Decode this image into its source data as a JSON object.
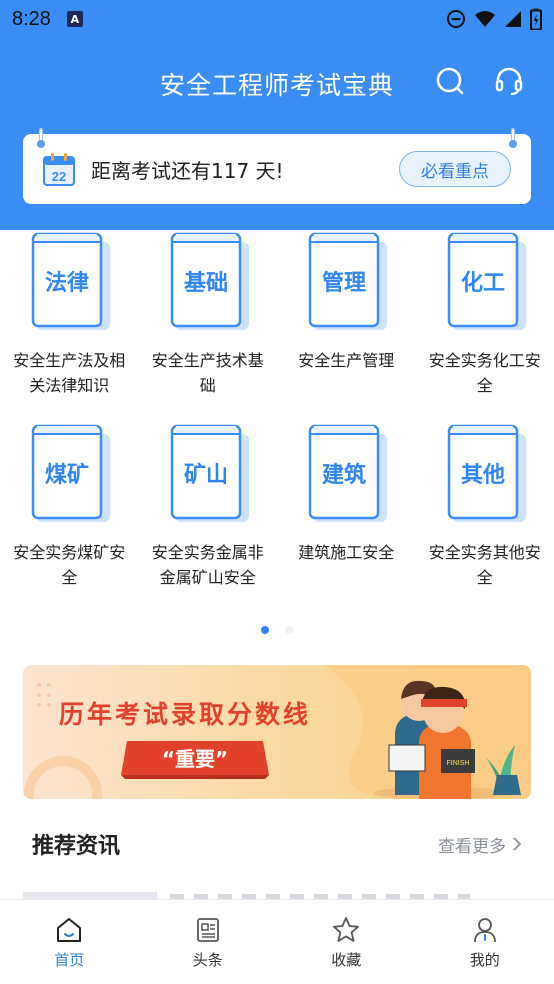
{
  "status_bar": {
    "time": "8:28",
    "notification_icon": "A"
  },
  "header": {
    "title": "安全工程师考试宝典",
    "search_icon": "search-icon",
    "support_icon": "headset-icon"
  },
  "exam_card": {
    "calendar_day": "22",
    "countdown_text": "距离考试还有117 天!",
    "button_label": "必看重点"
  },
  "categories": [
    {
      "book_title": "法律",
      "label": "安全生产法及相关法律知识"
    },
    {
      "book_title": "基础",
      "label": "安全生产技术基础"
    },
    {
      "book_title": "管理",
      "label": "安全生产管理"
    },
    {
      "book_title": "化工",
      "label": "安全实务化工安全"
    },
    {
      "book_title": "煤矿",
      "label": "安全实务煤矿安全"
    },
    {
      "book_title": "矿山",
      "label": "安全实务金属非金属矿山安全"
    },
    {
      "book_title": "建筑",
      "label": "建筑施工安全"
    },
    {
      "book_title": "其他",
      "label": "安全实务其他安全"
    }
  ],
  "pager": {
    "active_index": 0,
    "count": 2
  },
  "banner": {
    "title": "历年考试录取分数线",
    "tag": "“重要”",
    "book_text": "FINISH"
  },
  "news": {
    "title": "推荐资讯",
    "more_label": "查看更多"
  },
  "tabbar": [
    {
      "label": "首页",
      "icon": "home-icon",
      "active": true
    },
    {
      "label": "头条",
      "icon": "news-icon",
      "active": false
    },
    {
      "label": "收藏",
      "icon": "star-icon",
      "active": false
    },
    {
      "label": "我的",
      "icon": "user-icon",
      "active": false
    }
  ],
  "colors": {
    "primary": "#3b8df6",
    "accent_red": "#e2422c",
    "book_blue": "#2f86f0"
  }
}
